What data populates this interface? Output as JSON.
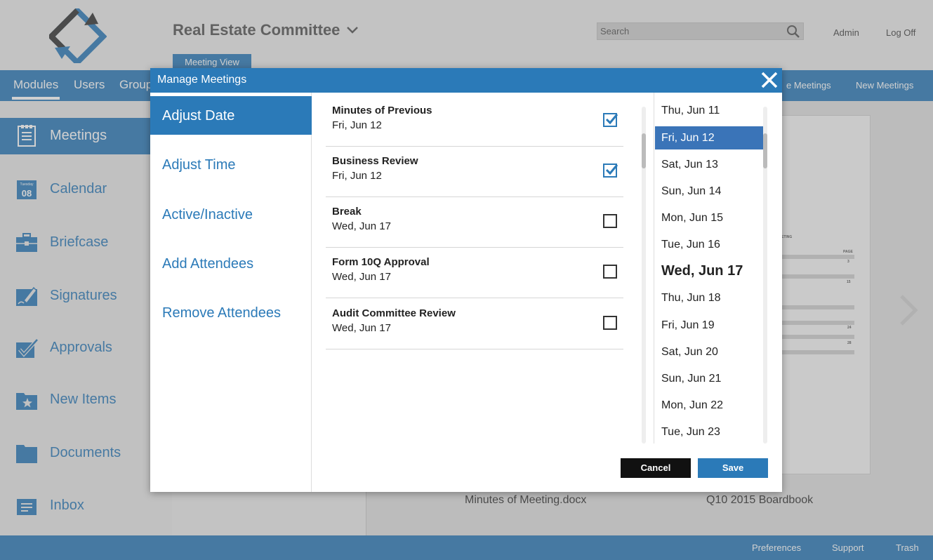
{
  "app": {
    "committee": "Real Estate Committee",
    "view_tab": "Meeting View",
    "search_placeholder": "Search",
    "admin": "Admin",
    "logoff": "Log Off"
  },
  "nav": {
    "items": [
      "Modules",
      "Users",
      "Group"
    ],
    "right_items": [
      "e Meetings",
      "New Meetings"
    ]
  },
  "sidebar": {
    "items": [
      {
        "label": "Meetings",
        "icon": "meetings-icon",
        "active": true
      },
      {
        "label": "Calendar",
        "icon": "calendar-icon",
        "calendar_day": "Tuesday",
        "calendar_date": "08"
      },
      {
        "label": "Briefcase",
        "icon": "briefcase-icon"
      },
      {
        "label": "Signatures",
        "icon": "signature-icon"
      },
      {
        "label": "Approvals",
        "icon": "approval-icon"
      },
      {
        "label": "New Items",
        "icon": "new-items-icon"
      },
      {
        "label": "Documents",
        "icon": "folder-icon"
      },
      {
        "label": "Inbox",
        "icon": "inbox-icon"
      }
    ]
  },
  "files": {
    "file1": "Minutes of Meeting.docx",
    "file2": "Q10 2015 Boardbook"
  },
  "doc_preview": {
    "heading": "ETING",
    "page_label": "PAGE",
    "pages": [
      "3",
      "15",
      "24",
      "28"
    ]
  },
  "footer": {
    "preferences": "Preferences",
    "support": "Support",
    "trash": "Trash"
  },
  "modal": {
    "title": "Manage Meetings",
    "menu": [
      {
        "label": "Adjust Date",
        "active": true
      },
      {
        "label": "Adjust Time"
      },
      {
        "label": "Active/Inactive"
      },
      {
        "label": "Add Attendees"
      },
      {
        "label": "Remove Attendees"
      }
    ],
    "meetings": [
      {
        "name": "Minutes of Previous",
        "date": "Fri, Jun 12",
        "checked": true
      },
      {
        "name": "Business Review",
        "date": "Fri, Jun 12",
        "checked": true
      },
      {
        "name": "Break",
        "date": "Wed, Jun 17",
        "checked": false
      },
      {
        "name": "Form 10Q Approval",
        "date": "Wed, Jun 17",
        "checked": false
      },
      {
        "name": "Audit Committee Review",
        "date": "Wed, Jun 17",
        "checked": false
      }
    ],
    "dates": [
      {
        "label": "Thu, Jun 11"
      },
      {
        "label": "Fri, Jun 12",
        "selected": true
      },
      {
        "label": "Sat, Jun 13"
      },
      {
        "label": "Sun, Jun 14"
      },
      {
        "label": "Mon, Jun 15"
      },
      {
        "label": "Tue, Jun 16"
      },
      {
        "label": "Wed, Jun 17",
        "emphasized": true
      },
      {
        "label": "Thu, Jun 18"
      },
      {
        "label": "Fri, Jun 19"
      },
      {
        "label": "Sat, Jun 20"
      },
      {
        "label": "Sun, Jun 21"
      },
      {
        "label": "Mon, Jun 22"
      },
      {
        "label": "Tue, Jun 23"
      }
    ],
    "cancel_label": "Cancel",
    "save_label": "Save"
  },
  "colors": {
    "accent": "#2b7ab8",
    "selected_date": "#3a74b8",
    "cancel": "#111111"
  }
}
